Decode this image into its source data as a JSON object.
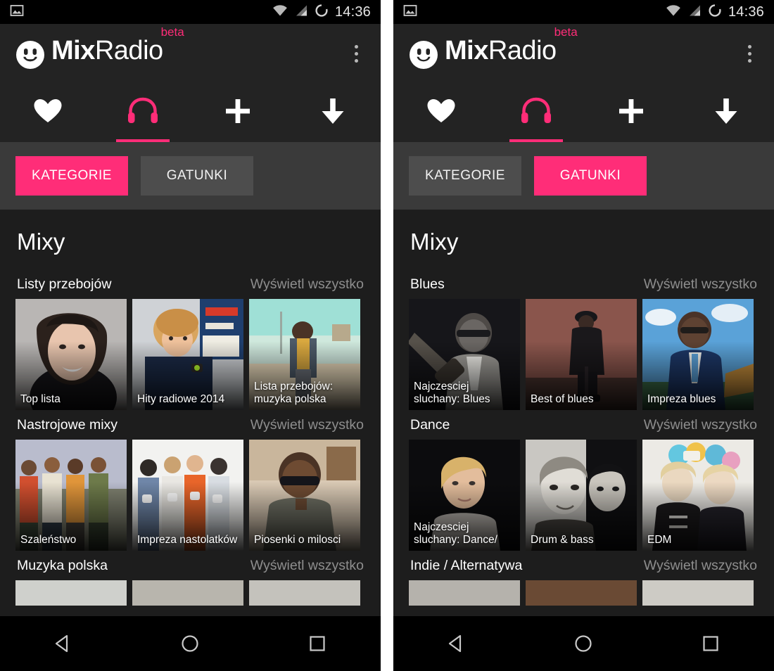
{
  "statusbar": {
    "time": "14:36",
    "icons": [
      "image-icon",
      "wifi-icon",
      "signal-icon",
      "battery-icon"
    ]
  },
  "appbar": {
    "logo_icon": "mixradio-smiley-icon",
    "title_bold": "Mix",
    "title_light": "Radio",
    "badge": "beta",
    "overflow_icon": "overflow-menu-icon"
  },
  "colors": {
    "accent": "#ff2d78",
    "appbar_bg": "#232323",
    "segbar_bg": "#3a3a3a",
    "content_bg": "#1d1d1d",
    "muted_text": "#8e8e8e"
  },
  "tabs": [
    {
      "name": "favourites",
      "icon": "heart-icon",
      "active": false
    },
    {
      "name": "mixes",
      "icon": "headphones-icon",
      "active": true
    },
    {
      "name": "create",
      "icon": "plus-icon",
      "active": false
    },
    {
      "name": "downloads",
      "icon": "download-arrow-icon",
      "active": false
    }
  ],
  "panels": [
    {
      "id": "left",
      "segments": [
        {
          "label": "KATEGORIE",
          "active": true
        },
        {
          "label": "GATUNKI",
          "active": false
        }
      ],
      "page_title": "Mixy",
      "sections": [
        {
          "name": "Listy przebojów",
          "see_all": "Wyświetl wszystko",
          "tiles": [
            {
              "label": "Top lista",
              "art": "portrait-smiling-woman"
            },
            {
              "label": "Hity radiowe 2014",
              "art": "portrait-young-man-cafe"
            },
            {
              "label": "Lista przebojów: muzyka polska",
              "art": "portrait-curly-hair-beach"
            }
          ]
        },
        {
          "name": "Nastrojowe mixy",
          "see_all": "Wyświetl wszystko",
          "tiles": [
            {
              "label": "Szaleństwo",
              "art": "group-colourful-shirts"
            },
            {
              "label": "Impreza nastolatków",
              "art": "teens-with-mugs"
            },
            {
              "label": "Piosenki o milosci",
              "art": "man-sunglasses-diner"
            }
          ]
        },
        {
          "name": "Muzyka polska",
          "see_all": "Wyświetl wszystko",
          "tiles": [
            {
              "label": "",
              "art": "clipped-tile-a"
            },
            {
              "label": "",
              "art": "clipped-tile-b"
            },
            {
              "label": "",
              "art": "clipped-tile-c"
            }
          ]
        }
      ]
    },
    {
      "id": "right",
      "segments": [
        {
          "label": "KATEGORIE",
          "active": false
        },
        {
          "label": "GATUNKI",
          "active": true
        }
      ],
      "page_title": "Mixy",
      "sections": [
        {
          "name": "Blues",
          "see_all": "Wyświetl wszystko",
          "tiles": [
            {
              "label": "Najczesciej sluchany: Blues",
              "art": "bluesman-with-guitar-bw"
            },
            {
              "label": "Best of blues",
              "art": "seated-bluesman-sepia"
            },
            {
              "label": "Impreza blues",
              "art": "bb-king-blue-suit-sky"
            }
          ]
        },
        {
          "name": "Dance",
          "see_all": "Wyświetl wszystko",
          "tiles": [
            {
              "label": "Najczesciej sluchany: Dance/",
              "art": "blond-man-dark-bg"
            },
            {
              "label": "Drum & bass",
              "art": "two-men-high-contrast"
            },
            {
              "label": "EDM",
              "art": "two-blonde-women-props"
            }
          ]
        },
        {
          "name": "Indie / Alternatywa",
          "see_all": "Wyświetl wszystko",
          "tiles": [
            {
              "label": "",
              "art": "clipped-tile-a"
            },
            {
              "label": "",
              "art": "clipped-tile-b"
            },
            {
              "label": "",
              "art": "clipped-tile-c"
            }
          ]
        }
      ]
    }
  ],
  "navbar": [
    {
      "name": "back",
      "icon": "back-triangle-icon"
    },
    {
      "name": "home",
      "icon": "home-circle-icon"
    },
    {
      "name": "recents",
      "icon": "recents-square-icon"
    }
  ]
}
